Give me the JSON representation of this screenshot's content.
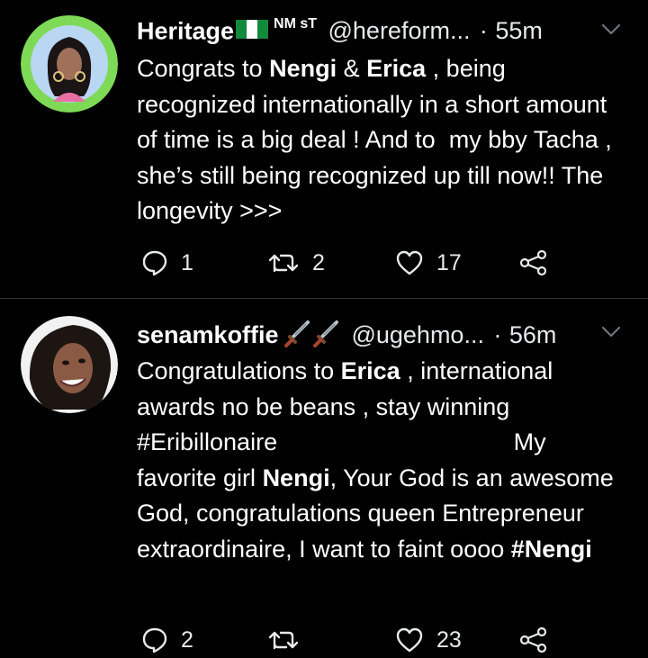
{
  "tweets": [
    {
      "display_name": "Heritage",
      "badge_text": "NM sT",
      "handle": "@hereform...",
      "separator": "·",
      "time": "55m",
      "body_parts": [
        {
          "text": "Congrats to ",
          "bold": false
        },
        {
          "text": "Nengi",
          "bold": true
        },
        {
          "text": " & ",
          "bold": false
        },
        {
          "text": "Erica",
          "bold": true
        },
        {
          "text": " , being recognized internationally in a short amount of time is a big deal ! And to  my bby Tacha , she’s still being recognized up till now!! The longevity >>>",
          "bold": false
        }
      ],
      "replies": "1",
      "retweets": "2",
      "likes": "17"
    },
    {
      "display_name": "senamkoffie",
      "handle": "@ugehmo...",
      "separator": "·",
      "time": "56m",
      "body_parts": [
        {
          "text": "Congratulations to ",
          "bold": false
        },
        {
          "text": "Erica",
          "bold": true
        },
        {
          "text": " , international awards no be beans , stay winning #Eribillonaire                                   My favorite girl ",
          "bold": false
        },
        {
          "text": "Nengi",
          "bold": true
        },
        {
          "text": ", Your God is an awesome God, congratulations queen Entrepreneur extraordinaire, I want to faint oooo ",
          "bold": false
        },
        {
          "text": "#Nengi",
          "bold": true
        }
      ],
      "replies": "2",
      "retweets": "",
      "likes": "23"
    }
  ],
  "colors": {
    "background": "#000000",
    "text": "#ffffff",
    "muted": "#e7e9ea",
    "divider": "#2f3336",
    "avatar1_ring": "#7ed957"
  },
  "icons": [
    "nigeria-flag-icon",
    "chevron-down-icon",
    "dagger-emoji-icon",
    "reply-icon",
    "retweet-icon",
    "like-icon",
    "share-icon"
  ]
}
